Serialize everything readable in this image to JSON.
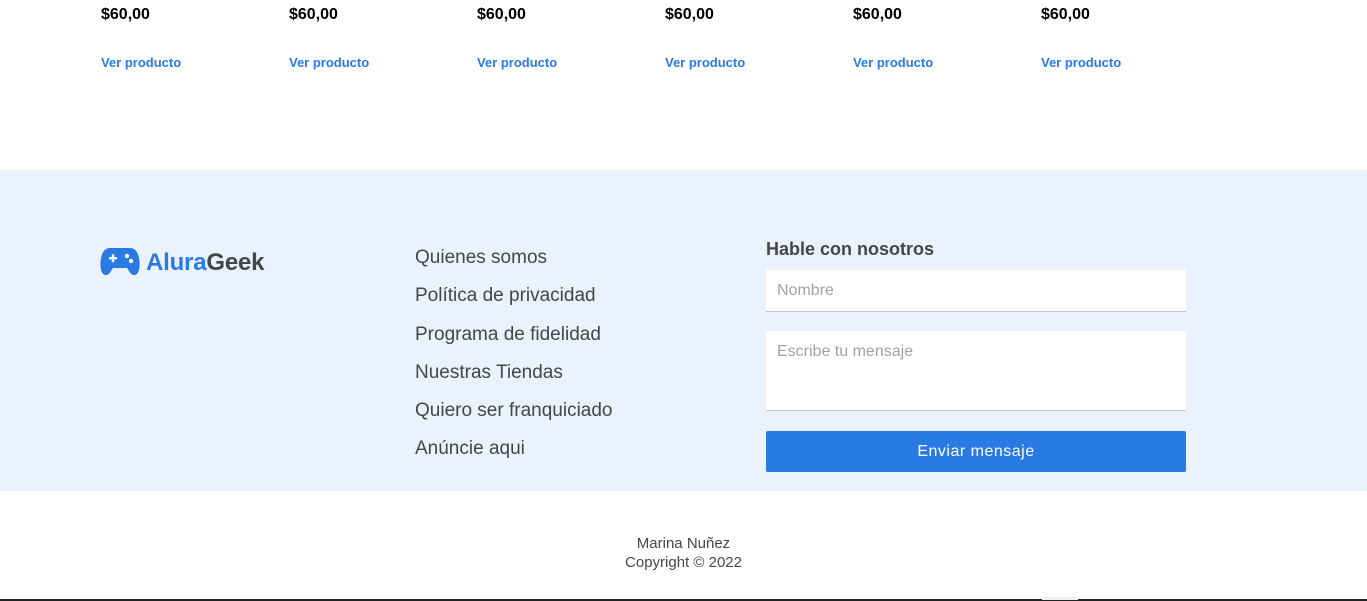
{
  "products": [
    {
      "price": "$60,00",
      "link_label": "Ver producto"
    },
    {
      "price": "$60,00",
      "link_label": "Ver producto"
    },
    {
      "price": "$60,00",
      "link_label": "Ver producto"
    },
    {
      "price": "$60,00",
      "link_label": "Ver producto"
    },
    {
      "price": "$60,00",
      "link_label": "Ver producto"
    },
    {
      "price": "$60,00",
      "link_label": "Ver producto"
    }
  ],
  "footer": {
    "logo": {
      "part1": "Alura",
      "part2": "Geek",
      "icon": "gamepad-icon"
    },
    "links": [
      "Quienes somos",
      "Política de privacidad",
      "Programa de fidelidad",
      "Nuestras Tiendas",
      "Quiero ser franquiciado",
      "Anúncie aqui"
    ],
    "contact": {
      "title": "Hable con nosotros",
      "name_placeholder": "Nombre",
      "message_placeholder": "Escribe tu mensaje",
      "button_label": "Enviar mensaje"
    }
  },
  "credits": {
    "author": "Marina Nuñez",
    "copyright": "Copyright © 2022"
  },
  "colors": {
    "accent": "#2a7ae4",
    "footer_bg": "#eaf2fd",
    "text": "#464646"
  }
}
